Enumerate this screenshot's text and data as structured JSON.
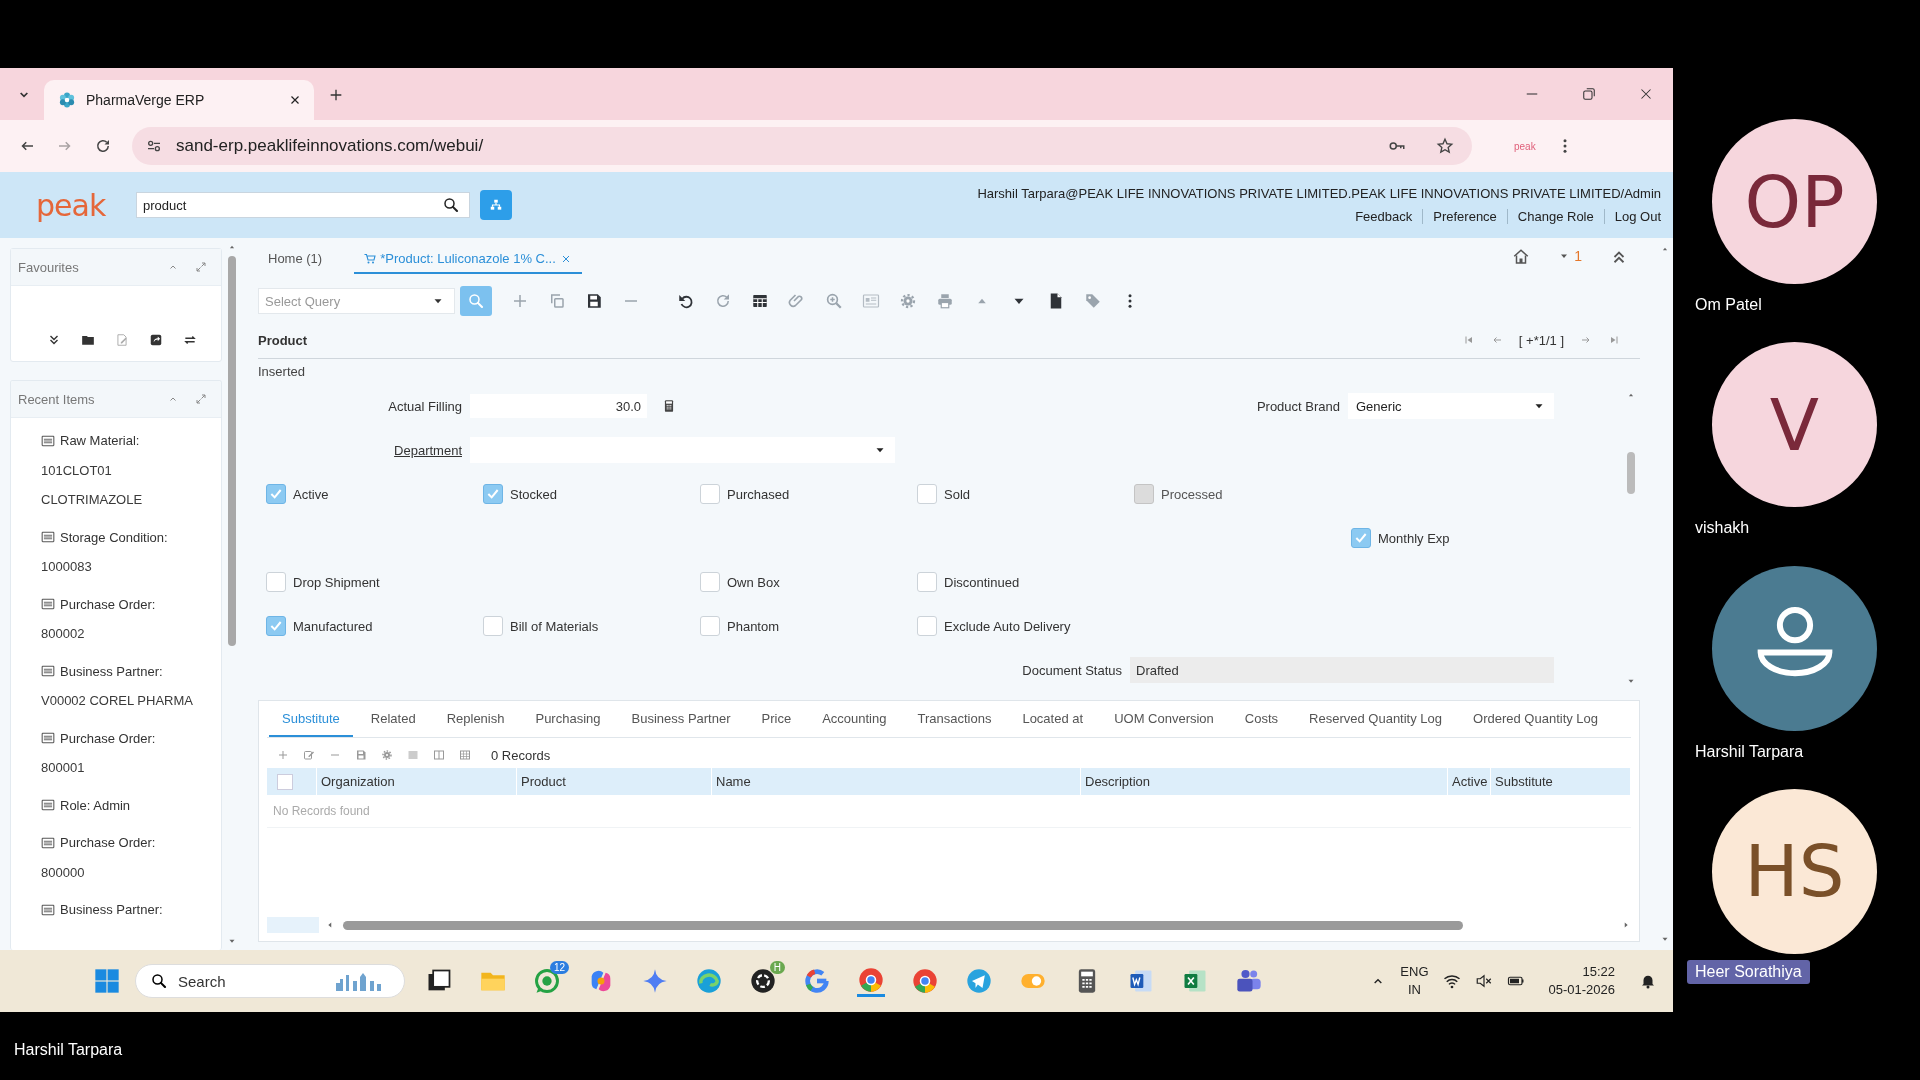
{
  "browser": {
    "tab_title": "PharmaVerge ERP",
    "url": "sand-erp.peaklifeinnovations.com/webui/",
    "extension_label": "peak"
  },
  "app": {
    "logo": "peak",
    "search_value": "product",
    "user_line": "Harshil Tarpara@PEAK LIFE INNOVATIONS PRIVATE LIMITED.PEAK LIFE INNOVATIONS PRIVATE LIMITED/Admin",
    "header_links": [
      "Feedback",
      "Preference",
      "Change Role",
      "Log Out"
    ]
  },
  "sidebar": {
    "favourites_title": "Favourites",
    "recent_title": "Recent Items",
    "recent_items": [
      {
        "title": "Raw Material:",
        "lines": [
          "101CLOT01",
          "CLOTRIMAZOLE"
        ]
      },
      {
        "title": "Storage Condition:",
        "lines": [
          "1000083"
        ]
      },
      {
        "title": "Purchase Order:",
        "lines": [
          "800002"
        ]
      },
      {
        "title": "Business Partner:",
        "lines": [
          "V00002 COREL PHARMA"
        ]
      },
      {
        "title": "Purchase Order:",
        "lines": [
          "800001"
        ]
      },
      {
        "title": "Role: Admin"
      },
      {
        "title": "Purchase Order:",
        "lines": [
          "800000"
        ]
      },
      {
        "title": "Business Partner:"
      }
    ]
  },
  "window_tabs": [
    {
      "label": "Home (1)",
      "selected": false,
      "closable": false
    },
    {
      "label": "*Product: Luliconazole 1% C...",
      "selected": true,
      "closable": true
    }
  ],
  "notification_count": "1",
  "toolbar": {
    "query_placeholder": "Select Query"
  },
  "record": {
    "title": "Product",
    "navigator": "[ +*1/1 ]",
    "status": "Inserted"
  },
  "fields": {
    "actual_filling": {
      "label": "Actual Filling",
      "value": "30.0"
    },
    "product_brand": {
      "label": "Product Brand",
      "value": "Generic"
    },
    "department": {
      "label": "Department"
    },
    "document_status": {
      "label": "Document Status",
      "value": "Drafted"
    }
  },
  "checkbox_rows": [
    [
      {
        "label": "Active",
        "checked": true,
        "disabled": false
      },
      {
        "label": "Stocked",
        "checked": true,
        "disabled": false
      },
      {
        "label": "Purchased",
        "checked": false,
        "disabled": false
      },
      {
        "label": "Sold",
        "checked": false,
        "disabled": false
      },
      {
        "label": "Processed",
        "checked": false,
        "disabled": true
      },
      null
    ],
    [
      null,
      null,
      null,
      null,
      null,
      {
        "label": "Monthly Exp",
        "checked": true,
        "disabled": false
      }
    ],
    [
      {
        "label": "Drop Shipment",
        "checked": false,
        "disabled": false
      },
      null,
      {
        "label": "Own Box",
        "checked": false,
        "disabled": false
      },
      {
        "label": "Discontinued",
        "checked": false,
        "disabled": false
      },
      null,
      null
    ],
    [
      {
        "label": "Manufactured",
        "checked": true,
        "disabled": false
      },
      {
        "label": "Bill of Materials",
        "checked": false,
        "disabled": false
      },
      {
        "label": "Phantom",
        "checked": false,
        "disabled": false
      },
      {
        "label": "Exclude Auto Delivery",
        "checked": false,
        "disabled": false
      },
      null,
      null
    ]
  ],
  "detail_tabs": [
    {
      "label": "Substitute",
      "selected": true
    },
    {
      "label": "Related",
      "selected": false
    },
    {
      "label": "Replenish",
      "selected": false
    },
    {
      "label": "Purchasing",
      "selected": false
    },
    {
      "label": "Business Partner",
      "selected": false
    },
    {
      "label": "Price",
      "selected": false
    },
    {
      "label": "Accounting",
      "selected": false
    },
    {
      "label": "Transactions",
      "selected": false
    },
    {
      "label": "Located at",
      "selected": false
    },
    {
      "label": "UOM Conversion",
      "selected": false
    },
    {
      "label": "Costs",
      "selected": false
    },
    {
      "label": "Reserved Quantity Log",
      "selected": false
    },
    {
      "label": "Ordered Quantity Log",
      "selected": false
    }
  ],
  "detail": {
    "select_all_checked": false,
    "records": "0 Records",
    "columns": [
      "Organization",
      "Product",
      "Name",
      "Description",
      "Active",
      "Substitute"
    ],
    "empty_message": "No Records found"
  },
  "taskbar": {
    "search_placeholder": "Search",
    "message_badge": "12",
    "profile_badge": "H",
    "language": "ENG",
    "region": "IN",
    "time": "15:22",
    "date": "05-01-2026"
  },
  "participants": [
    {
      "kind": "initials",
      "initials": "OP",
      "name": "Om Patel",
      "color": "#f6d6dd",
      "speaking": false
    },
    {
      "kind": "initials",
      "initials": "V",
      "name": "vishakh",
      "color": "#f6d6dd",
      "speaking": false
    },
    {
      "kind": "avatar",
      "name": "Harshil Tarpara",
      "color": "#4b7b91",
      "speaking": false
    },
    {
      "kind": "initials",
      "initials": "HS",
      "name": "Heer Sorathiya",
      "color": "#fbe8d6",
      "speaking": true
    }
  ],
  "presenter": "Harshil Tarpara"
}
